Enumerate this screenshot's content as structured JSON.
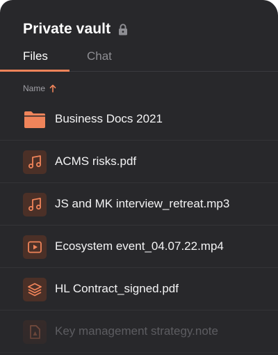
{
  "header": {
    "title": "Private vault",
    "lock_icon": "lock-icon"
  },
  "tabs": [
    {
      "label": "Files",
      "active": true
    },
    {
      "label": "Chat",
      "active": false
    }
  ],
  "sort": {
    "label": "Name",
    "direction_icon": "arrow-up-icon"
  },
  "files": [
    {
      "name": "Business Docs 2021",
      "icon": "folder-icon"
    },
    {
      "name": "ACMS risks.pdf",
      "icon": "music-note-icon"
    },
    {
      "name": "JS and MK interview_retreat.mp3",
      "icon": "music-note-icon"
    },
    {
      "name": "Ecosystem event_04.07.22.mp4",
      "icon": "video-play-icon"
    },
    {
      "name": "HL Contract_signed.pdf",
      "icon": "layers-icon"
    },
    {
      "name": "Key management strategy.note",
      "icon": "note-icon"
    }
  ],
  "colors": {
    "accent": "#f0845a",
    "background": "#28282b",
    "icon_tile": "#4b3027"
  }
}
